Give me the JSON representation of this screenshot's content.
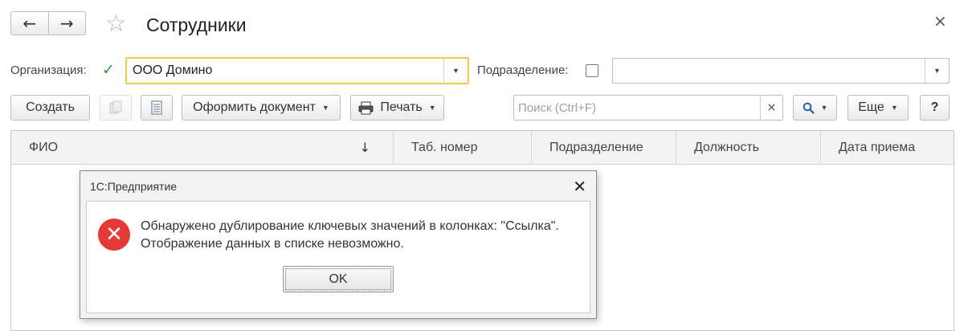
{
  "window": {
    "title": "Сотрудники",
    "back_icon": "←",
    "forward_icon": "→",
    "star_icon": "☆",
    "close_icon": "×"
  },
  "filters": {
    "organization_label": "Организация:",
    "organization_checked": true,
    "organization_check_glyph": "✓",
    "organization_value": "ООО Домино",
    "subdivision_label": "Подразделение:",
    "subdivision_checked": false,
    "subdivision_value": ""
  },
  "toolbar": {
    "create_label": "Создать",
    "make_document_label": "Оформить документ",
    "print_label": "Печать",
    "search_placeholder": "Поиск (Ctrl+F)",
    "search_clear_glyph": "×",
    "more_label": "Еще",
    "help_label": "?"
  },
  "table": {
    "sort_glyph": "↓",
    "columns": [
      "ФИО",
      "Таб. номер",
      "Подразделение",
      "Должность",
      "Дата приема"
    ]
  },
  "dialog": {
    "title": "1С:Предприятие",
    "close_glyph": "✕",
    "message_line1": "Обнаружено дублирование ключевых значений в колонках: \"Ссылка\".",
    "message_line2": "Отображение данных в списке невозможно.",
    "ok_label": "OK",
    "error_glyph": "✕"
  },
  "colors": {
    "focus_border": "#f2c94c",
    "check_green": "#2c9a3c",
    "error_red": "#e53935"
  }
}
